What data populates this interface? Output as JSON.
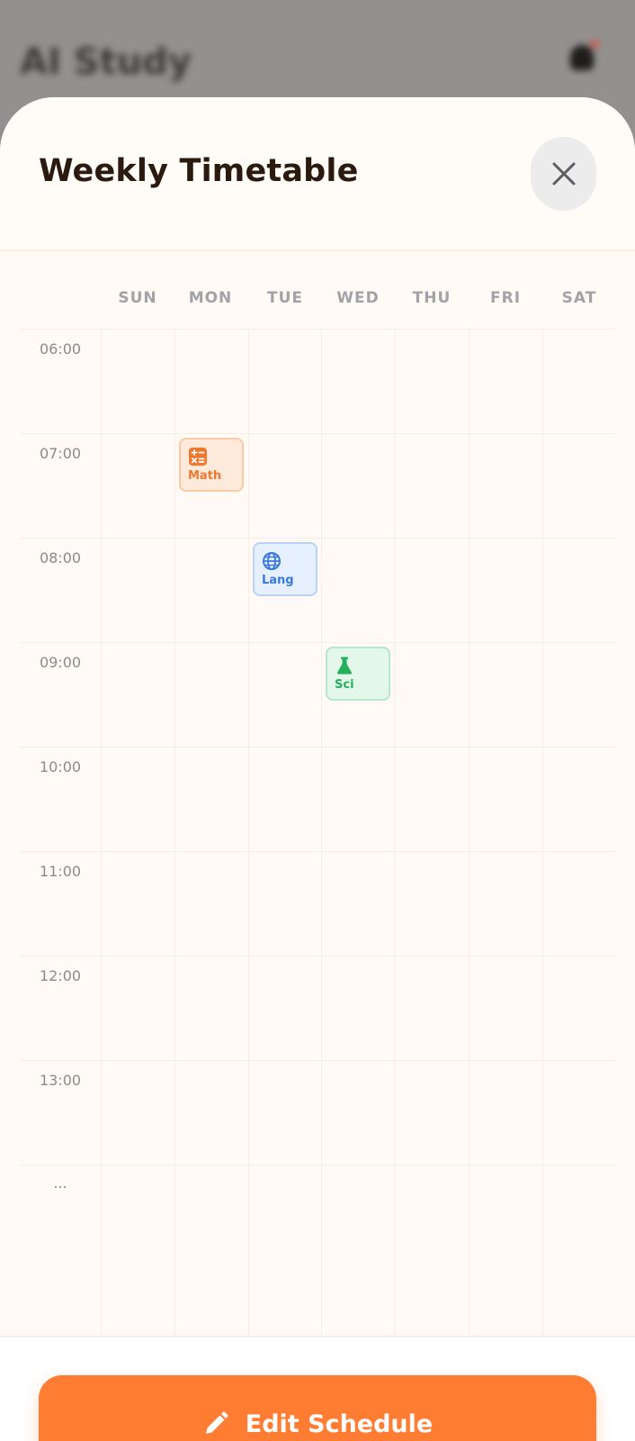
{
  "background_app": {
    "title": "AI Study",
    "notification_icon": "bell-icon"
  },
  "sheet": {
    "title": "Weekly Timetable",
    "close_icon": "close-icon"
  },
  "timetable": {
    "days": [
      "SUN",
      "MON",
      "TUE",
      "WED",
      "THU",
      "FRI",
      "SAT"
    ],
    "times": [
      "06:00",
      "07:00",
      "08:00",
      "09:00",
      "10:00",
      "11:00",
      "12:00",
      "13:00",
      "..."
    ],
    "events": [
      {
        "label": "Math",
        "day": "MON",
        "time": "07:00",
        "icon": "calculator-icon",
        "color": "#f0772d"
      },
      {
        "label": "Lang",
        "day": "TUE",
        "time": "08:00",
        "icon": "globe-icon",
        "color": "#3a78e0"
      },
      {
        "label": "Sci",
        "day": "WED",
        "time": "09:00",
        "icon": "flask-icon",
        "color": "#26b059"
      }
    ]
  },
  "footer": {
    "edit_button_label": "Edit Schedule",
    "edit_button_icon": "pencil-icon",
    "accent_color": "#ff7c33"
  }
}
